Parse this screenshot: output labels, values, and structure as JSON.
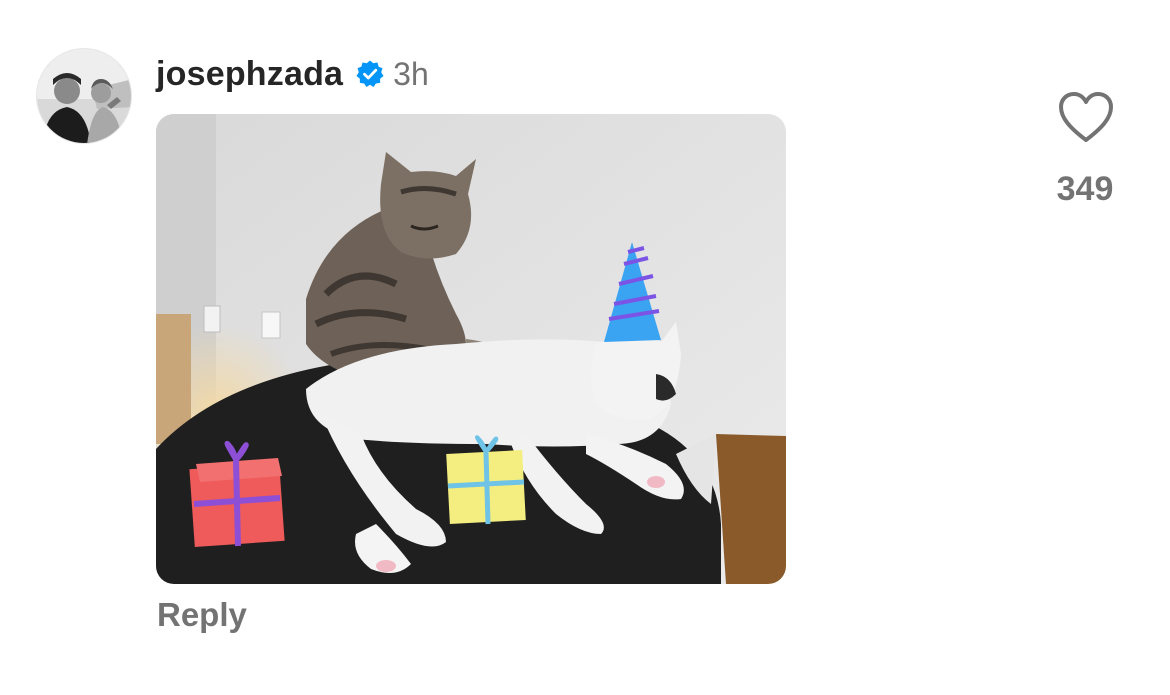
{
  "comment": {
    "username": "josephzada",
    "verified": true,
    "time": "3h",
    "reply_label": "Reply",
    "like_count": "349",
    "like_icon": "heart-outline-icon",
    "verified_icon": "verified-badge-icon",
    "media_type": "gif"
  },
  "colors": {
    "text_primary": "#262626",
    "text_secondary": "#737373",
    "verified_blue": "#0095f6"
  }
}
